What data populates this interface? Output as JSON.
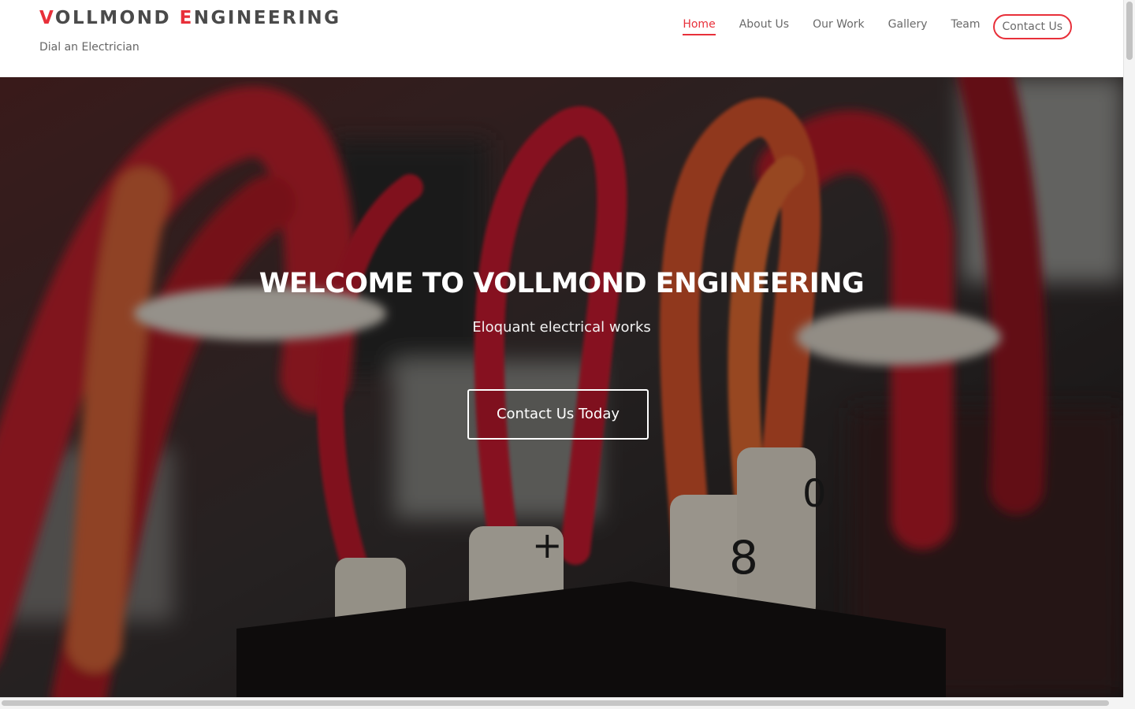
{
  "brand": {
    "logo_parts": [
      {
        "text": "V",
        "accent": true
      },
      {
        "text": "OLLMOND ",
        "accent": false
      },
      {
        "text": "E",
        "accent": true
      },
      {
        "text": "NGINEERING",
        "accent": false
      }
    ],
    "tagline": "Dial an Electrician"
  },
  "nav": {
    "items": [
      {
        "label": "Home",
        "active": true
      },
      {
        "label": "About Us",
        "active": false
      },
      {
        "label": "Our Work",
        "active": false
      },
      {
        "label": "Gallery",
        "active": false
      },
      {
        "label": "Team",
        "active": false
      }
    ],
    "cta_label": "Contact Us"
  },
  "hero": {
    "title": "WELCOME TO VOLLMOND ENGINEERING",
    "subtitle": "Eloquant electrical works",
    "cta_label": "Contact Us Today",
    "image_subject": "close-up of red and orange electrical wires with numbered cable markers in a distribution panel"
  },
  "colors": {
    "accent": "#e8303a",
    "nav_text": "#6a6a6a",
    "logo_text": "#4a4a4a",
    "hero_text": "#ffffff"
  },
  "scroll": {
    "vertical_position": 0,
    "horizontal_position": 0
  }
}
